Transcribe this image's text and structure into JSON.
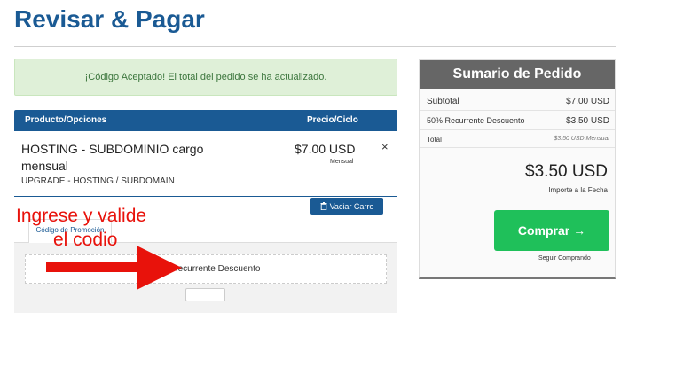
{
  "page": {
    "title": "Revisar & Pagar"
  },
  "alert": {
    "message": "¡Código Aceptado! El total del pedido se ha actualizado."
  },
  "cart": {
    "header": {
      "product": "Producto/Opciones",
      "price": "Precio/Ciclo"
    },
    "item": {
      "name": "HOSTING - SUBDOMINIO cargo mensual",
      "group": "UPGRADE - HOSTING / SUBDOMAIN",
      "price": "$7.00 USD",
      "cycle": "Mensual",
      "remove": "×"
    },
    "empty_button": "Vaciar Carro",
    "empty_icon": "trash-icon"
  },
  "promo": {
    "tab_label": "Código de Promoción",
    "applied": "50% Recurrente Descuento"
  },
  "annotation": {
    "line1": "Ingrese y valide",
    "line2": "el codio",
    "color": "#e8120b"
  },
  "summary": {
    "title": "Sumario de Pedido",
    "subtotal_label": "Subtotal",
    "subtotal_value": "$7.00 USD",
    "discount_label": "50% Recurrente Descuento",
    "discount_value": "$3.50 USD",
    "total_label": "Total",
    "total_value": "$3.50 USD Mensual",
    "due_amount": "$3.50 USD",
    "due_label": "Importe a la Fecha",
    "checkout_button": "Comprar →",
    "continue_link": "Seguir Comprando"
  },
  "colors": {
    "brand_blue": "#1a5a94",
    "success_green": "#1fc05a",
    "alert_bg": "#dff0d8"
  }
}
